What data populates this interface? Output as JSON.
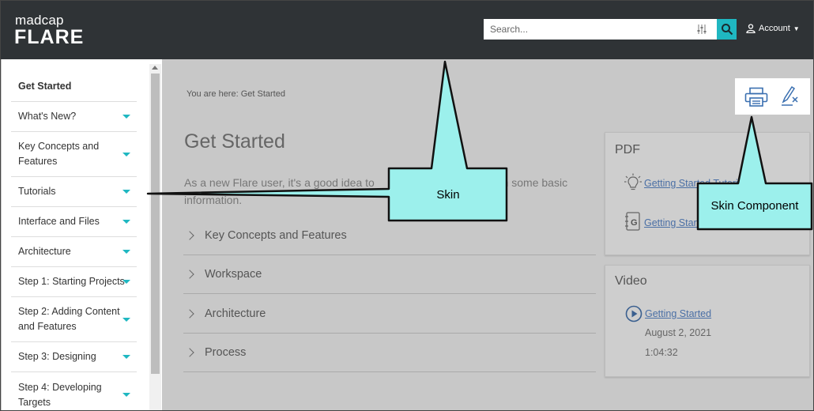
{
  "logo": {
    "line1": "madcap",
    "line2": "FLARE"
  },
  "search": {
    "placeholder": "Search...",
    "icon": "search-icon",
    "filter_icon": "filter-sliders-icon"
  },
  "account": {
    "label": "Account",
    "icon": "user-icon"
  },
  "sidebar": {
    "items": [
      {
        "label": "Get Started",
        "expandable": false,
        "active": true
      },
      {
        "label": "What's New?",
        "expandable": true
      },
      {
        "label": "Key Concepts and Features",
        "expandable": true
      },
      {
        "label": "Tutorials",
        "expandable": true
      },
      {
        "label": "Interface and Files",
        "expandable": true
      },
      {
        "label": "Architecture",
        "expandable": true
      },
      {
        "label": "Step 1: Starting Projects",
        "expandable": true
      },
      {
        "label": "Step 2: Adding Content and Features",
        "expandable": true
      },
      {
        "label": "Step 3: Designing",
        "expandable": true
      },
      {
        "label": "Step 4: Developing Targets",
        "expandable": true
      }
    ]
  },
  "main": {
    "breadcrumb": "You are here: Get Started",
    "title": "Get Started",
    "intro_visible_left": "As a new Flare user, it's a good idea to",
    "intro_visible_right": "h some basic",
    "intro_line2": "information.",
    "accordion": [
      {
        "label": "Key Concepts and Features"
      },
      {
        "label": "Workspace"
      },
      {
        "label": "Architecture"
      },
      {
        "label": "Process"
      }
    ]
  },
  "toolbar": {
    "print_icon": "printer-icon",
    "clear_highlight_icon": "clear-highlight-icon"
  },
  "pdf_card": {
    "title": "PDF",
    "links": [
      {
        "label": "Getting Started Tutorial",
        "icon": "lightbulb-icon"
      },
      {
        "label": "Getting Started Guide",
        "icon": "guide-book-icon"
      }
    ]
  },
  "video_card": {
    "title": "Video",
    "link": "Getting Started",
    "icon": "play-circle-icon",
    "date": "August 2, 2021",
    "duration": "1:04:32"
  },
  "callouts": {
    "skin": "Skin",
    "skin_component": "Skin Component"
  },
  "colors": {
    "header": "#2f3336",
    "accent": "#1fb7c1",
    "callout_fill": "#9cf0ec",
    "overlay": "#c8c8c8"
  }
}
